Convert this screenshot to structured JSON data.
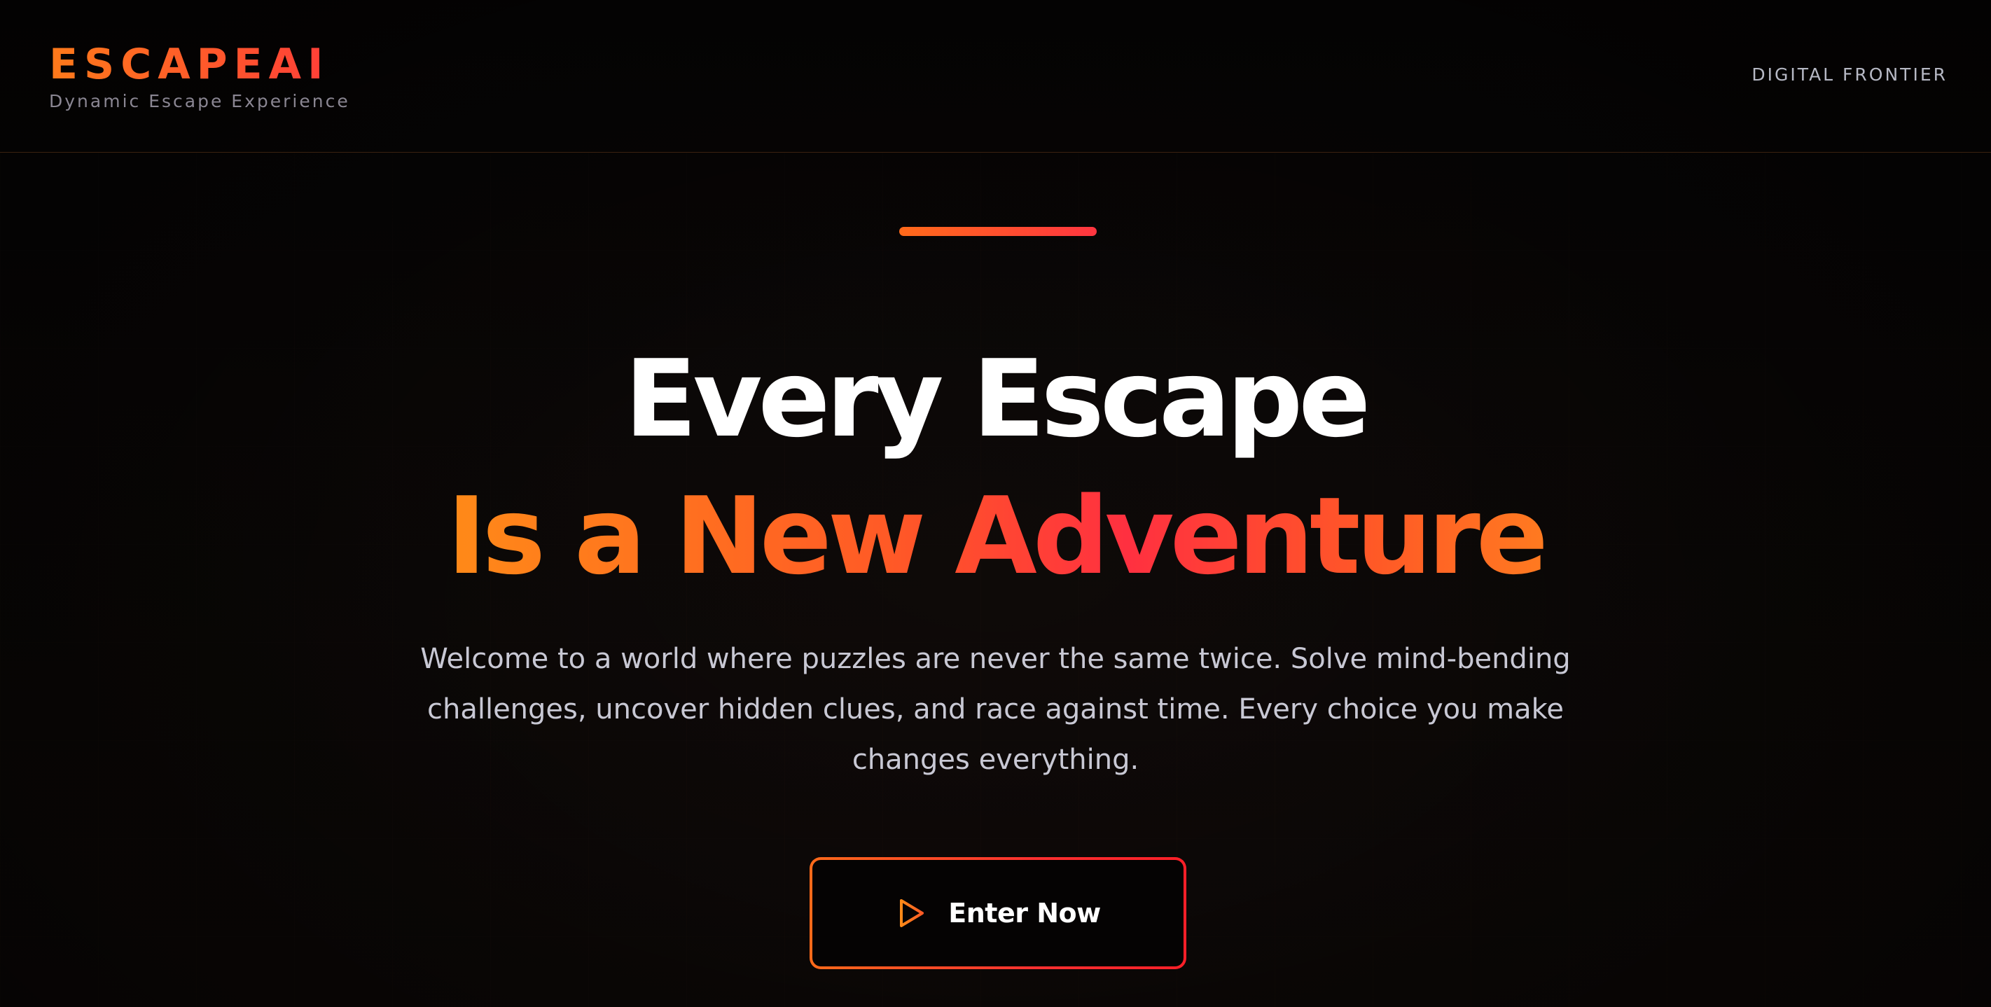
{
  "header": {
    "logo": "ESCAPEAI",
    "tagline": "Dynamic Escape Experience",
    "nav_link": "DIGITAL FRONTIER"
  },
  "hero": {
    "headline_line1": "Every Escape",
    "headline_line2": "Is a New Adventure",
    "description": "Welcome to a world where puzzles are never the same twice. Solve mind-bending challenges, uncover hidden clues, and race against time. Every choice you make changes everything.",
    "cta_label": "Enter Now",
    "cta_icon": "play-icon"
  },
  "colors": {
    "background": "#0a0707",
    "accent_orange": "#ff7a1a",
    "accent_red": "#ff3040",
    "text_light": "#c8c8d4",
    "muted": "#8a8692"
  }
}
